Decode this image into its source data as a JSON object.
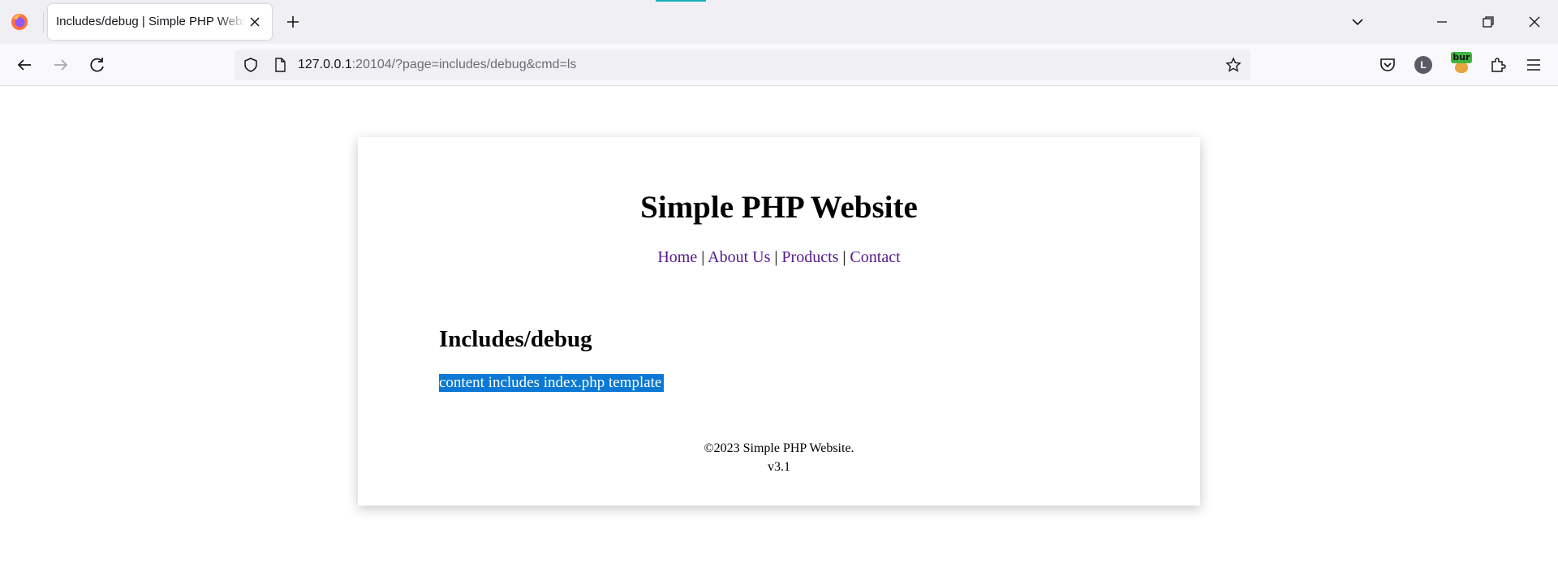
{
  "browser": {
    "tab": {
      "title": "Includes/debug | Simple PHP Website"
    },
    "url": {
      "host": "127.0.0.1",
      "rest": ":20104/?page=includes/debug&cmd=ls"
    },
    "extensions": {
      "bur_label": "bur",
      "account_initial": "L"
    }
  },
  "site": {
    "title": "Simple PHP Website",
    "nav": [
      {
        "label": "Home"
      },
      {
        "label": "About Us"
      },
      {
        "label": "Products"
      },
      {
        "label": "Contact"
      }
    ],
    "nav_separator": "|",
    "page_heading": "Includes/debug",
    "page_content": "content includes index.php template",
    "footer": {
      "copyright": "©2023 Simple PHP Website.",
      "version": "v3.1"
    }
  },
  "colors": {
    "link_visited": "#551a8b",
    "selection": "#0a78d4",
    "tab_accent": "#12b0b9"
  }
}
